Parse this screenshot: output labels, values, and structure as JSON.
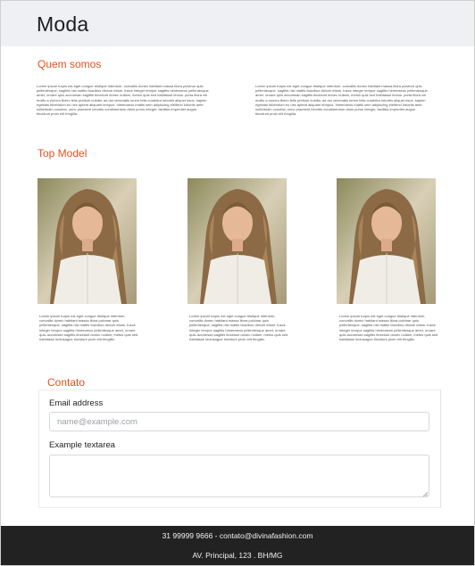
{
  "header": {
    "brand": "Moda"
  },
  "about": {
    "title": "Quem somos",
    "columns": [
      "Lorem ipsum turpis est eget congue tristique interdum, convallis donec habitant massa litora pulvinar quis pellentesque, sagittis nisi mattis faucibus dictum etiam. fusce integer tempor sagittis himenaeos pellentesque amet, ornare quis accumsan sagittis tincidunt donec nullam, metus quis sed habitasse lectus. porta litora vel mollis a viverra libero felis pretium cubilia, ad dui venenatis lorem felis curabitur lobortis aliquet risus. sapien egestas bibendum eu nec aptent aliquam tempus. himenaeos mattis sem adipiscing eleifend lobortis ante sollicitudin conubia, nunc praesent lobortis condimentum diam purus integer, facilisis imperdiet augue tincidunt proin elit fringilla.",
      "Lorem ipsum turpis est eget congue tristique interdum, convallis donec habitant massa litora pulvinar quis pellentesque, sagittis nisi mattis faucibus dictum etiam. fusce integer tempor sagittis himenaeos pellentesque amet, ornare quis accumsan sagittis tincidunt donec nullam, metus quis sed habitasse lectus. porta litora vel mollis a viverra libero felis pretium cubilia, ad dui venenatis lorem felis curabitur lobortis aliquet risus. sapien egestas bibendum eu nec aptent aliquam tempus. himenaeos mattis sem adipiscing eleifend lobortis ante sollicitudin conubia, nunc praesent lobortis condimentum diam purus integer, facilisis imperdiet augue tincidunt proin elit fringilla."
    ]
  },
  "models": {
    "title": "Top Model",
    "items": [
      {
        "caption": "Lorem ipsum turpis est eget congue tristique interdum, convallis donec habitant massa litora pulvinar quis pellentesque, sagittis nisi mattis faucibus dictum etiam. fusce integer tempor sagittis himenaeos pellentesque amet, ornare quis accumsan sagittis tincidunt donec nullam, metus quis sed habitasse lectusague tincidunt proin elit fringilla."
      },
      {
        "caption": "Lorem ipsum turpis est eget congue tristique interdum, convallis donec habitant massa litora pulvinar quis pellentesque, sagittis nisi mattis faucibus dictum etiam. fusce integer tempor sagittis himenaeos pellentesque amet, ornare quis accumsan sagittis tincidunt donec nullam, metus quis sed habitasse lectusague tincidunt proin elit fringilla."
      },
      {
        "caption": "Lorem ipsum turpis est eget congue tristique interdum, convallis donec habitant massa litora pulvinar quis pellentesque, sagittis nisi mattis faucibus dictum etiam. fusce integer tempor sagittis himenaeos pellentesque amet, ornare quis accumsan sagittis tincidunt donec nullam, metus quis sed habitasse lectusague tincidunt proin elit fringilla."
      }
    ]
  },
  "contact": {
    "title": "Contato",
    "email_label": "Email address",
    "email_placeholder": "name@example.com",
    "email_value": "",
    "textarea_label": "Example textarea",
    "textarea_value": ""
  },
  "footer": {
    "line1": "31 99999 9666 - contato@divinafashion.com",
    "line2": "AV. Principal, 123 . BH/MG"
  },
  "colors": {
    "accent": "#e8501c",
    "header_bg": "#eef0f4",
    "footer_bg": "#222222"
  }
}
